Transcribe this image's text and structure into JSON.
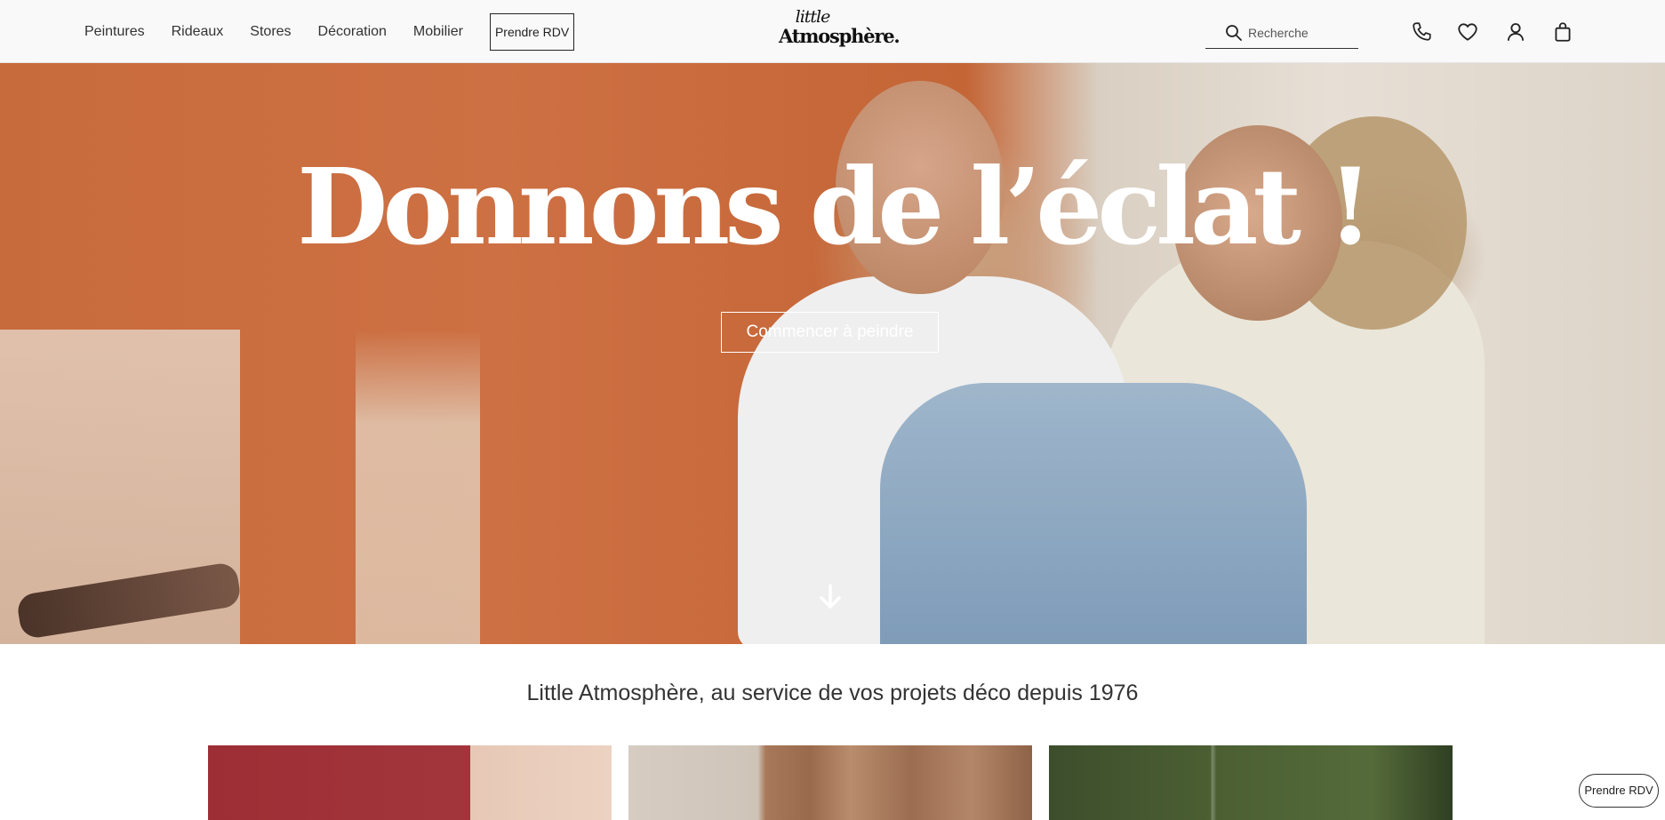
{
  "header": {
    "nav": [
      "Peintures",
      "Rideaux",
      "Stores",
      "Décoration",
      "Mobilier"
    ],
    "rdv_label": "Prendre RDV",
    "logo": {
      "small": "little",
      "main": "Atmosphère."
    },
    "search_placeholder": "Recherche",
    "icons": [
      "phone-icon",
      "heart-icon",
      "user-icon",
      "bag-icon"
    ]
  },
  "hero": {
    "title": "Donnons de l’éclat !",
    "cta": "Commencer à peindre",
    "scroll_icon": "arrow-down-icon"
  },
  "tagline": "Little Atmosphère, au service de vos projets déco depuis 1976",
  "floating_button": "Prendre RDV",
  "colors": {
    "header_bg": "#f9f9f9",
    "terracotta": "#c86b3c",
    "text": "#333333"
  }
}
